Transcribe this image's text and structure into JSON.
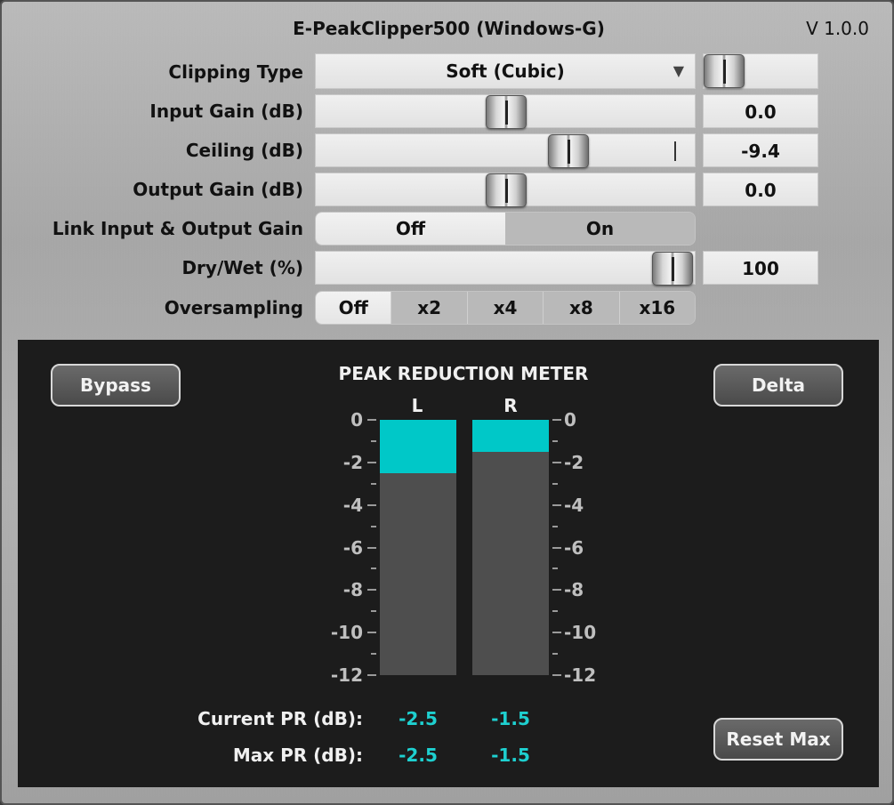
{
  "header": {
    "title": "E-PeakClipper500 (Windows-G)",
    "version": "V 1.0.0"
  },
  "params": {
    "clipping_type": {
      "label": "Clipping Type",
      "value": "Soft (Cubic)"
    },
    "input_gain": {
      "label": "Input Gain (dB)",
      "value": "0.0"
    },
    "ceiling": {
      "label": "Ceiling (dB)",
      "value": "-9.4"
    },
    "output_gain": {
      "label": "Output Gain (dB)",
      "value": "0.0"
    },
    "link": {
      "label": "Link Input & Output Gain",
      "off": "Off",
      "on": "On",
      "selected": "Off"
    },
    "dry_wet": {
      "label": "Dry/Wet (%)",
      "value": "100"
    },
    "oversampling": {
      "label": "Oversampling",
      "options": [
        "Off",
        "x2",
        "x4",
        "x8",
        "x16"
      ],
      "selected": "Off"
    }
  },
  "meter": {
    "title": "PEAK REDUCTION METER",
    "channels": [
      "L",
      "R"
    ],
    "scale": [
      "0",
      "-2",
      "-4",
      "-6",
      "-8",
      "-10",
      "-12"
    ],
    "reduction_db": {
      "L": 2.5,
      "R": 1.5
    },
    "bypass_label": "Bypass",
    "delta_label": "Delta",
    "reset_label": "Reset Max",
    "current_label": "Current PR (dB):",
    "max_label": "Max PR (dB):",
    "current": {
      "L": "-2.5",
      "R": "-1.5"
    },
    "max": {
      "L": "-2.5",
      "R": "-1.5"
    }
  },
  "colors": {
    "meter_fill": "#00c8c8",
    "readout": "#1ed0d0",
    "panel_bg": "#1c1c1c"
  }
}
